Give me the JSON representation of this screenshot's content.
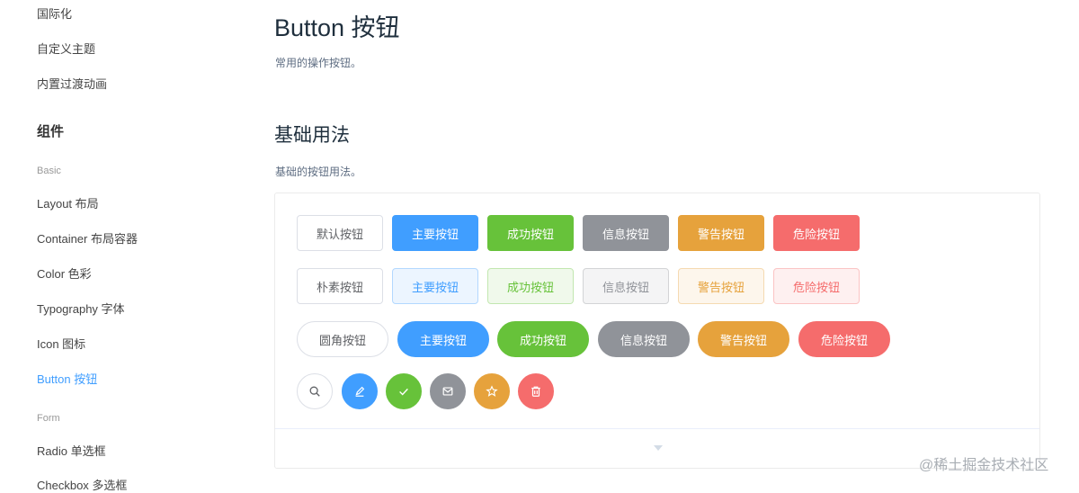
{
  "sidebar": {
    "top_items": [
      "国际化",
      "自定义主题",
      "内置过渡动画"
    ],
    "section_title": "组件",
    "group_basic": "Basic",
    "basic_items": [
      "Layout 布局",
      "Container 布局容器",
      "Color 色彩",
      "Typography 字体",
      "Icon 图标",
      "Button 按钮"
    ],
    "active_item": "Button 按钮",
    "group_form": "Form",
    "form_items": [
      "Radio 单选框",
      "Checkbox 多选框"
    ]
  },
  "main": {
    "title": "Button 按钮",
    "description": "常用的操作按钮。",
    "section_title": "基础用法",
    "section_description": "基础的按钮用法。"
  },
  "demo": {
    "row_default": [
      "默认按钮",
      "主要按钮",
      "成功按钮",
      "信息按钮",
      "警告按钮",
      "危险按钮"
    ],
    "row_plain": [
      "朴素按钮",
      "主要按钮",
      "成功按钮",
      "信息按钮",
      "警告按钮",
      "危险按钮"
    ],
    "row_round": [
      "圆角按钮",
      "主要按钮",
      "成功按钮",
      "信息按钮",
      "警告按钮",
      "危险按钮"
    ],
    "row_circle_icons": [
      "search-icon",
      "edit-icon",
      "check-icon",
      "message-icon",
      "star-icon",
      "delete-icon"
    ]
  },
  "colors": {
    "primary": "#409eff",
    "success": "#67c23a",
    "info": "#909399",
    "warning": "#e6a23c",
    "danger": "#f56c6c"
  },
  "watermark": "@稀土掘金技术社区"
}
